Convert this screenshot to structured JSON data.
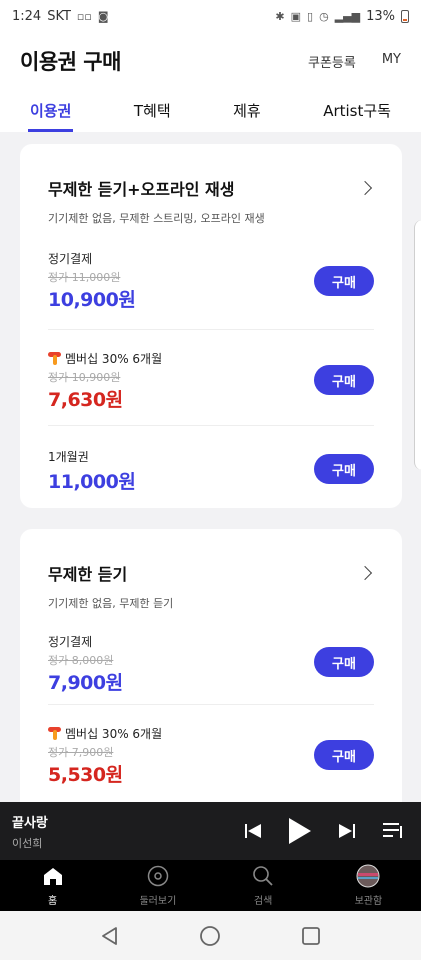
{
  "status_bar": {
    "time": "1:24",
    "carrier": "SKT",
    "battery": "13%"
  },
  "header": {
    "title": "이용권 구매",
    "coupon_label": "쿠폰등록",
    "my_label": "MY"
  },
  "tabs": [
    {
      "label": "이용권",
      "active": true
    },
    {
      "label": "T혜택",
      "active": false
    },
    {
      "label": "제휴",
      "active": false
    },
    {
      "label": "Artist구독",
      "active": false
    }
  ],
  "cards": [
    {
      "title": "무제한 듣기+오프라인 재생",
      "description": "기기제한 없음, 무제한 스트리밍, 오프라인 재생",
      "plans": [
        {
          "label": "정기결제",
          "original_price": "정가 11,000원",
          "price": "10,900원",
          "button": "구매"
        },
        {
          "label": "멤버십 30% 6개월",
          "original_price": "정가 10,900원",
          "price": "7,630원",
          "button": "구매"
        },
        {
          "label": "1개월권",
          "price": "11,000원",
          "button": "구매"
        }
      ]
    },
    {
      "title": "무제한 듣기",
      "description": "기기제한 없음, 무제한 듣기",
      "plans": [
        {
          "label": "정기결제",
          "original_price": "정가 8,000원",
          "price": "7,900원",
          "button": "구매"
        },
        {
          "label": "멤버십 30% 6개월",
          "original_price": "정가 7,900원",
          "price": "5,530원",
          "button": "구매"
        }
      ]
    }
  ],
  "player": {
    "song": "끝사랑",
    "artist": "이선희"
  },
  "bottom_nav": [
    {
      "label": "홈",
      "icon": "home-icon",
      "active": true
    },
    {
      "label": "둘러보기",
      "icon": "disc-icon",
      "active": false
    },
    {
      "label": "검색",
      "icon": "search-icon",
      "active": false
    },
    {
      "label": "보관함",
      "icon": "avatar-icon",
      "active": false
    }
  ],
  "colors": {
    "accent": "#3d3fe0",
    "discount": "#d5261f"
  }
}
